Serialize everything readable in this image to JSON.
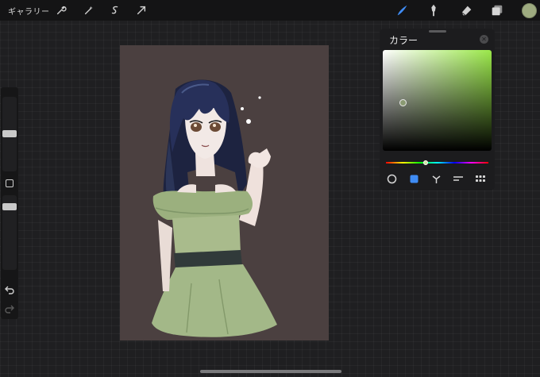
{
  "topbar": {
    "gallery_label": "ギャラリー",
    "left_tools": [
      "wrench-icon",
      "magic-wand-icon",
      "selection-s-icon",
      "transform-arrow-icon"
    ],
    "right_tools": [
      "brush-icon",
      "smudge-icon",
      "eraser-icon",
      "layers-icon"
    ],
    "active_tool": "brush-icon",
    "accent_color": "#3f8cf4",
    "current_color": "#9eab80"
  },
  "color_panel": {
    "title": "カラー",
    "hue_color": "#9be84a",
    "modes": [
      "disc-icon",
      "classic-icon",
      "harmony-icon",
      "value-icon",
      "palettes-icon"
    ],
    "active_mode": "classic-icon"
  },
  "sidebar": {
    "brush_size_level": 0.62,
    "opacity_level": 0.55
  },
  "canvas": {
    "background_color": "#4b4040",
    "artwork": "illustration-girl-green-dress"
  }
}
